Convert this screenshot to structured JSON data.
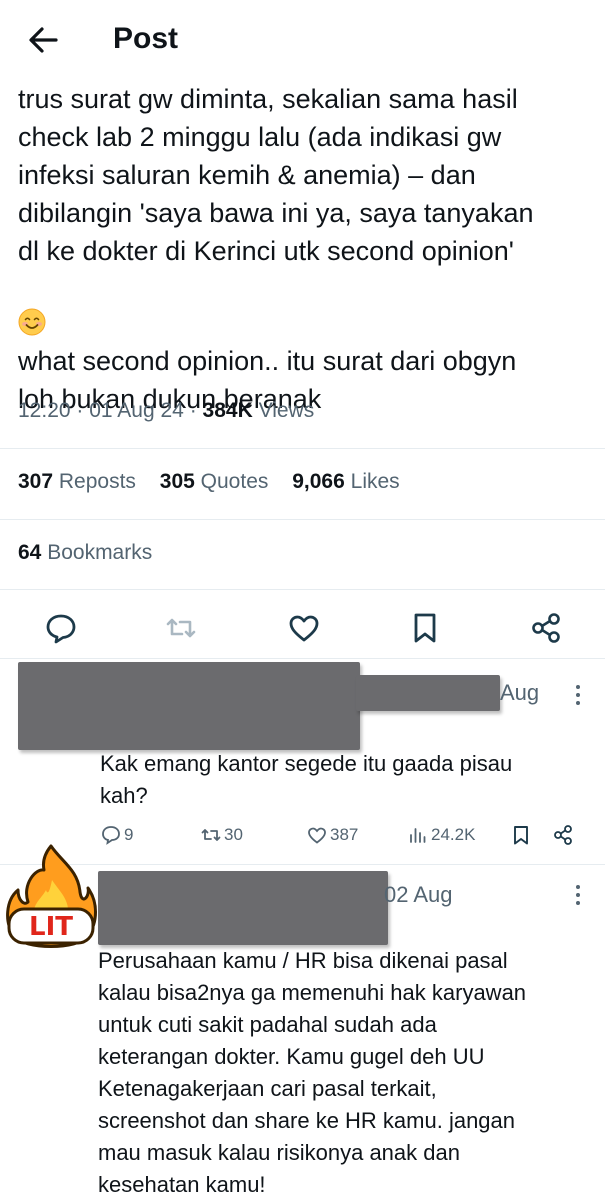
{
  "header": {
    "title": "Post"
  },
  "tweet": {
    "text": "trus surat gw diminta, sekalian sama hasil\ncheck lab 2 minggu lalu (ada indikasi gw\ninfeksi saluran kemih & anemia) – dan\ndibilangin 'saya bawa ini ya, saya tanyakan\ndl ke dokter di Kerinci utk second opinion'",
    "emoji": "smiling-face-icon",
    "text2": "what second opinion.. itu surat dari obgyn\nloh bukan dukun beranak",
    "time": "12:20",
    "date": "01 Aug 24",
    "views_count": "384K",
    "views_label": "Views",
    "dot": "·"
  },
  "stats": {
    "reposts_count": "307",
    "reposts_label": "Reposts",
    "quotes_count": "305",
    "quotes_label": "Quotes",
    "likes_count": "9,066",
    "likes_label": "Likes",
    "bookmarks_count": "64",
    "bookmarks_label": "Bookmarks"
  },
  "replies": [
    {
      "date": "Aug",
      "text": "Kak emang kantor segede itu gaada pisau\nkah?",
      "replies": "9",
      "reposts": "30",
      "likes": "387",
      "views": "24.2K"
    },
    {
      "date": "02 Aug",
      "sticker": "LIT",
      "text": "Perusahaan kamu / HR  bisa dikenai pasal\nkalau bisa2nya ga memenuhi hak karyawan\nuntuk cuti sakit padahal sudah ada\nketerangan dokter. Kamu gugel deh UU\nKetenagakerjaan cari pasal terkait,\nscreenshot dan share ke HR kamu. jangan\nmau masuk kalau risikonya anak dan\nkesehatan kamu!"
    }
  ],
  "colors": {
    "text": "#0f1419",
    "muted": "#536471",
    "redaction": "#6b6b6e"
  }
}
